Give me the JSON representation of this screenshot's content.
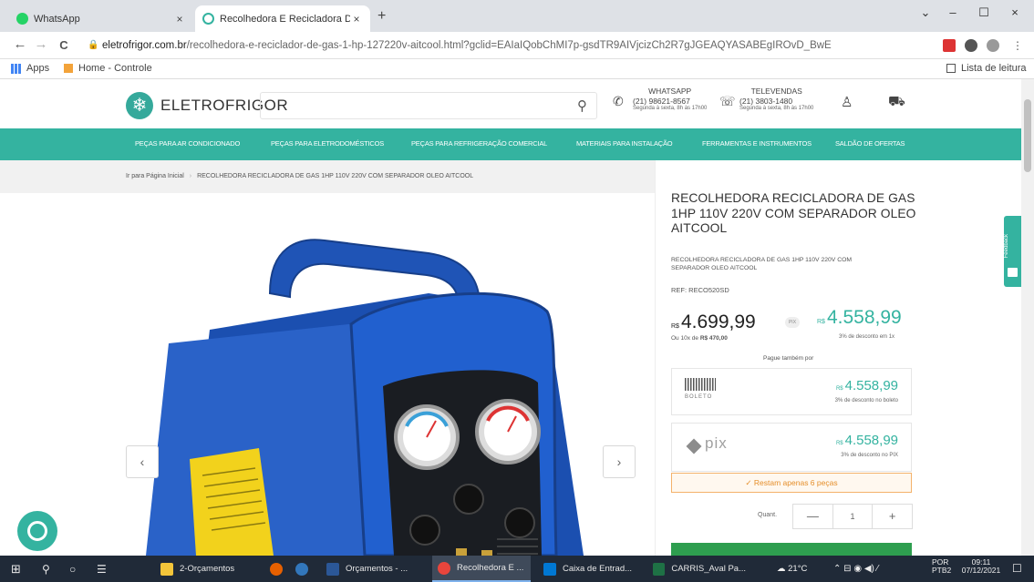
{
  "browser": {
    "tabs": [
      {
        "title": "WhatsApp",
        "close": "×"
      },
      {
        "title": "Recolhedora E Recicladora De Ga",
        "close": "×"
      }
    ],
    "new_tab": "+",
    "window_controls": {
      "dropdown": "⌄",
      "minimize": "–",
      "maximize": "☐",
      "close": "×"
    },
    "nav": {
      "back": "←",
      "forward": "→",
      "reload": "C"
    },
    "url_domain": "eletrofrigor.com.br",
    "url_path": "/recolhedora-e-reciclador-de-gas-1-hp-127220v-aitcool.html?gclid=EAIaIQobChMI7p-gsdTR9AIVjcizCh2R7gJGEAQYASABEgIROvD_BwE",
    "bookmarks": {
      "apps": "Apps",
      "home": "Home - Controle",
      "reading_list": "Lista de leitura"
    }
  },
  "header": {
    "logo": "ELETROFRIGOR",
    "whatsapp": {
      "label": "WHATSAPP",
      "phone": "(21) 98621-8567",
      "hours": "Segunda à sexta, 8h às 17h00"
    },
    "televendas": {
      "label": "TELEVENDAS",
      "phone": "(21) 3803-1480",
      "hours": "Segunda à sexta, 8h às 17h00"
    }
  },
  "menu": [
    "PEÇAS PARA AR CONDICIONADO",
    "PEÇAS PARA ELETRODOMÉSTICOS",
    "PEÇAS PARA REFRIGERAÇÃO COMERCIAL",
    "MATERIAIS PARA INSTALAÇÃO",
    "FERRAMENTAS E INSTRUMENTOS",
    "SALDÃO DE OFERTAS"
  ],
  "breadcrumb": {
    "home": "Ir para Página Inicial",
    "sep": "›",
    "current": "RECOLHEDORA RECICLADORA DE GAS 1HP 110V 220V COM SEPARADOR OLEO AITCOOL"
  },
  "product": {
    "title": "RECOLHEDORA RECICLADORA DE GAS 1HP 110V 220V COM SEPARADOR OLEO AITCOOL",
    "subtitle": "RECOLHEDORA RECICLADORA DE GAS 1HP 110V 220V COM SEPARADOR OLEO AITCOOL",
    "ref": "REF: RECO520SD",
    "currency": "R$",
    "price_old": "4.699,99",
    "installments_prefix": "Ou 10x de ",
    "installments_value": "R$ 470,00",
    "pix_chip": "PIX",
    "price_new": "4.558,99",
    "discount": "3% de desconto em 1x",
    "alt_payment": "Pague também por",
    "boleto": {
      "label": "BOLETO",
      "price": "4.558,99",
      "desc": "3% de desconto no boleto"
    },
    "pix": {
      "label": "pix",
      "price": "4.558,99",
      "desc": "3% de desconto no PIX"
    },
    "stock": "Restam apenas 6 peças",
    "qty_label": "Quant.",
    "qty": "1",
    "minus": "—",
    "plus": "+",
    "feedback": "Feedback",
    "prev": "‹",
    "next": "›"
  },
  "taskbar": {
    "apps": [
      {
        "label": "2-Orçamentos",
        "color": "#f3c53a"
      },
      {
        "label": "Orçamentos - ...",
        "color": "#2b5797"
      },
      {
        "label": "Recolhedora E ...",
        "color": "#e8453c"
      },
      {
        "label": "Caixa de Entrad...",
        "color": "#0078d4"
      },
      {
        "label": "CARRIS_Aval Pa...",
        "color": "#1e7145"
      }
    ],
    "weather": "21°C",
    "lang": "POR",
    "lang_sub": "PTB2",
    "time": "09:11",
    "date": "07/12/2021"
  }
}
